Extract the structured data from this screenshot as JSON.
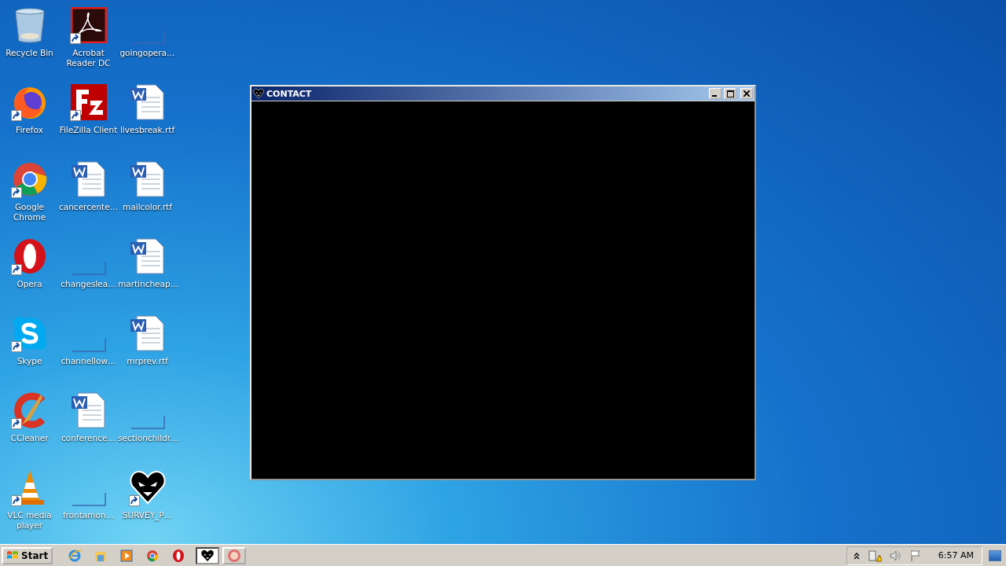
{
  "desktop": {
    "icons": [
      {
        "label": "Recycle Bin",
        "kind": "recycle",
        "shortcut": false
      },
      {
        "label": "Firefox",
        "kind": "firefox",
        "shortcut": true
      },
      {
        "label": "Google Chrome",
        "kind": "chrome",
        "shortcut": true
      },
      {
        "label": "Opera",
        "kind": "opera",
        "shortcut": true
      },
      {
        "label": "Skype",
        "kind": "skype",
        "shortcut": true
      },
      {
        "label": "CCleaner",
        "kind": "ccleaner",
        "shortcut": true
      },
      {
        "label": "VLC media player",
        "kind": "vlc",
        "shortcut": true
      },
      {
        "label": "Acrobat Reader DC",
        "kind": "acrobat",
        "shortcut": true
      },
      {
        "label": "FileZilla Client",
        "kind": "filezilla",
        "shortcut": true
      },
      {
        "label": "cancercente…",
        "kind": "word",
        "shortcut": false
      },
      {
        "label": "changeslea…",
        "kind": "blank",
        "shortcut": false
      },
      {
        "label": "channellow…",
        "kind": "blank",
        "shortcut": false
      },
      {
        "label": "conference…",
        "kind": "word",
        "shortcut": false
      },
      {
        "label": "frontamon…",
        "kind": "blank",
        "shortcut": false
      },
      {
        "label": "goingopera…",
        "kind": "blank",
        "shortcut": false
      },
      {
        "label": "livesbreak.rtf",
        "kind": "word",
        "shortcut": false
      },
      {
        "label": "mailcolor.rtf",
        "kind": "word",
        "shortcut": false
      },
      {
        "label": "martincheap…",
        "kind": "word",
        "shortcut": false
      },
      {
        "label": "mrprev.rtf",
        "kind": "word",
        "shortcut": false
      },
      {
        "label": "sectionchildr…",
        "kind": "blank",
        "shortcut": false
      },
      {
        "label": "SURVEY_P…",
        "kind": "heart",
        "shortcut": true
      }
    ]
  },
  "window": {
    "title": "CONTACT"
  },
  "taskbar": {
    "start": "Start",
    "quick_launch": [
      {
        "kind": "ie"
      },
      {
        "kind": "explorer"
      },
      {
        "kind": "media"
      },
      {
        "kind": "chrome"
      },
      {
        "kind": "opera"
      }
    ],
    "tasks": [
      {
        "kind": "heart",
        "selected": true
      },
      {
        "kind": "app",
        "selected": false
      }
    ],
    "tray": [
      {
        "kind": "chevron"
      },
      {
        "kind": "network"
      },
      {
        "kind": "volume"
      },
      {
        "kind": "flag"
      }
    ],
    "clock": "6:57 AM"
  }
}
